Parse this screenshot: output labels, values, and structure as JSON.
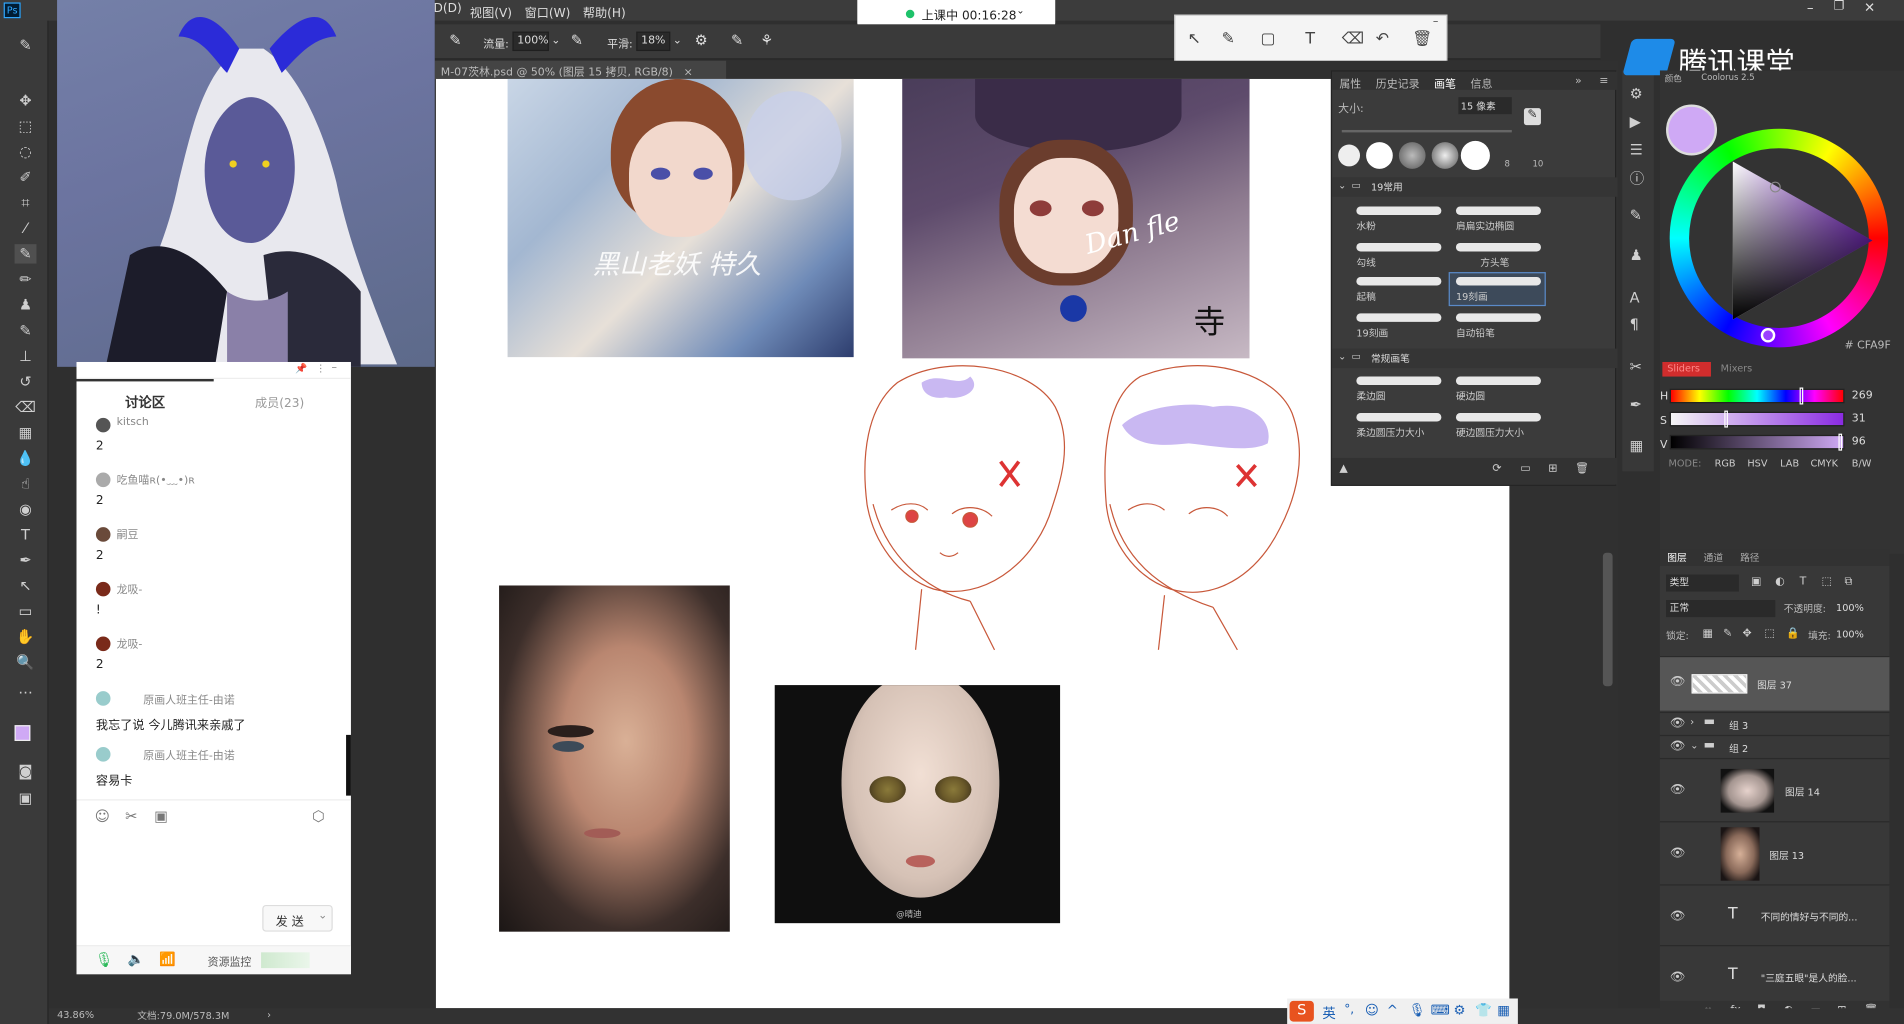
{
  "menu": {
    "items": [
      "D(D)",
      "视图(V)",
      "窗口(W)",
      "帮助(H)"
    ]
  },
  "options": {
    "flow_label": "流量:",
    "flow_value": "100%",
    "smooth_label": "平滑:",
    "smooth_value": "18%"
  },
  "document": {
    "tab_title": "M-07茨林.psd @ 50% (图层 15 拷贝, RGB/8)",
    "close": "×"
  },
  "timer": {
    "text": "上课中 00:16:28"
  },
  "logo": {
    "text": "腾讯课堂"
  },
  "chat": {
    "tabs": [
      "讨论区",
      "成员(23)"
    ],
    "messages": [
      {
        "name": "kitsch",
        "text": "2",
        "color": "#555"
      },
      {
        "name": "吃鱼喵ʀ(•﹏•)ʀ",
        "text": "2",
        "color": "#aaa"
      },
      {
        "name": "嗣豆",
        "text": "2",
        "color": "#6a4a3a"
      },
      {
        "name": "龙吸-",
        "text": "!",
        "color": "#7a2a1a"
      },
      {
        "name": "龙吸-",
        "text": "2",
        "color": "#7a2a1a"
      },
      {
        "name": "原画人班主任-由诺",
        "text": "我忘了说 今儿腾讯来亲戚了",
        "color": "#9cc"
      },
      {
        "name": "原画人班主任-由诺",
        "text": "容易卡",
        "color": "#9cc"
      }
    ],
    "send_label": "发 送",
    "resource_label": "资源监控"
  },
  "brush_panel": {
    "tabs": [
      "属性",
      "历史记录",
      "画笔",
      "信息"
    ],
    "size_label": "大小:",
    "size_value": "15 像素",
    "preset_sizes": [
      "8",
      "10"
    ],
    "group1": "19常用",
    "group1_brushes": [
      "水粉",
      "肩扁实边椭圆",
      "勾线",
      "方头笔",
      "起稿",
      "19刻画",
      "19刻画",
      "自动铅笔"
    ],
    "group2": "常规画笔",
    "group2_brushes": [
      "柔边圆",
      "硬边圆",
      "柔边圆压力大小",
      "硬边圆压力大小"
    ]
  },
  "color_panel": {
    "tabs": [
      "颜色",
      "Coolorus 2.5"
    ],
    "hex": "# CFA9F",
    "slider_tabs": [
      "Sliders",
      "Mixers"
    ],
    "h_label": "H",
    "h_value": "269",
    "s_label": "S",
    "s_value": "31",
    "v_label": "V",
    "v_value": "96",
    "modes": [
      "MODE:",
      "RGB",
      "HSV",
      "LAB",
      "CMYK",
      "B/W"
    ],
    "current_color": "#cfa9f5"
  },
  "layers_panel": {
    "tabs": [
      "图层",
      "通道",
      "路径"
    ],
    "filter": "类型",
    "blend_mode": "正常",
    "opacity_label": "不透明度:",
    "opacity_value": "100%",
    "lock_label": "锁定:",
    "fill_label": "填充:",
    "fill_value": "100%",
    "layers": [
      {
        "name": "图层 37",
        "type": "image"
      },
      {
        "name": "组 3",
        "type": "group"
      },
      {
        "name": "组 2",
        "type": "group"
      },
      {
        "name": "图层 14",
        "type": "image"
      },
      {
        "name": "图层 13",
        "type": "image"
      },
      {
        "name": "不同的情好与不同的...",
        "type": "text"
      },
      {
        "name": "\"三庭五眼\"是人的脸...",
        "type": "text"
      }
    ]
  },
  "status": {
    "zoom": "43.86%",
    "doc": "文档:79.0M/578.3M"
  },
  "canvas_text": {
    "art1": "黑山老妖 特久",
    "art2": "Dan fle",
    "art2_sig": "寺",
    "watermark": "@晴迪"
  },
  "taskbar": {
    "ime": "英"
  }
}
